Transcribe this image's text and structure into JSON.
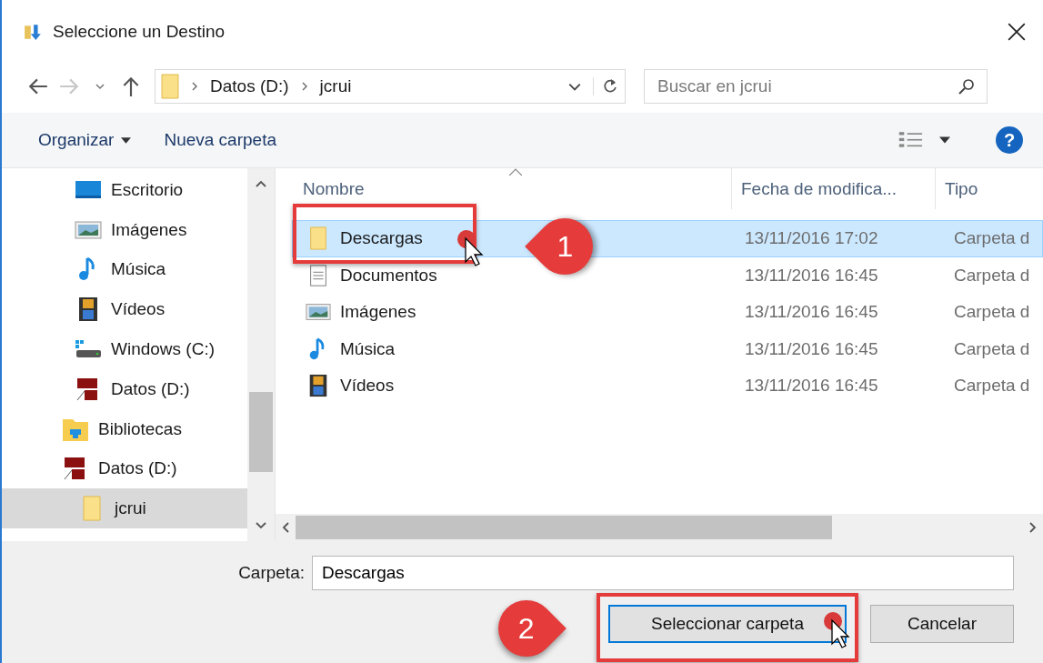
{
  "window": {
    "title": "Seleccione un Destino"
  },
  "address": {
    "crumbs": [
      "Datos (D:)",
      "jcrui"
    ]
  },
  "search": {
    "placeholder": "Buscar en jcrui"
  },
  "toolbar": {
    "organize": "Organizar",
    "new_folder": "Nueva carpeta",
    "help": "?"
  },
  "sidebar": {
    "items": [
      {
        "children": [
          {
            "label": "Escritorio",
            "kind": "desktop",
            "selected": false
          },
          {
            "label": "Imágenes",
            "kind": "pictures",
            "selected": false
          },
          {
            "label": "Música",
            "kind": "music",
            "selected": false
          },
          {
            "label": "Vídeos",
            "kind": "video",
            "selected": false
          },
          {
            "label": "Windows (C:)",
            "kind": "drive",
            "selected": false
          },
          {
            "label": "Datos (D:)",
            "kind": "sd",
            "selected": false
          }
        ]
      },
      {
        "label": "Bibliotecas",
        "kind": "library",
        "selected": false
      },
      {
        "label": "Datos (D:)",
        "kind": "sd",
        "selected": false,
        "children": [
          {
            "label": "jcrui",
            "kind": "folder",
            "selected": true
          }
        ]
      }
    ]
  },
  "table": {
    "columns": [
      "Nombre",
      "Fecha de modifica...",
      "Tipo"
    ],
    "rows": [
      {
        "name": "Descargas",
        "date": "13/11/2016 17:02",
        "type": "Carpeta d",
        "kind": "folder",
        "selected": true
      },
      {
        "name": "Documentos",
        "date": "13/11/2016 16:45",
        "type": "Carpeta d",
        "kind": "documents",
        "selected": false
      },
      {
        "name": "Imágenes",
        "date": "13/11/2016 16:45",
        "type": "Carpeta d",
        "kind": "pictures",
        "selected": false
      },
      {
        "name": "Música",
        "date": "13/11/2016 16:45",
        "type": "Carpeta d",
        "kind": "music",
        "selected": false
      },
      {
        "name": "Vídeos",
        "date": "13/11/2016 16:45",
        "type": "Carpeta d",
        "kind": "video",
        "selected": false
      }
    ]
  },
  "folder_field": {
    "label": "Carpeta:",
    "value": "Descargas"
  },
  "buttons": [
    {
      "label": "Seleccionar carpeta",
      "default": true
    },
    {
      "label": "Cancelar",
      "default": false
    }
  ],
  "annotations": [
    {
      "number": "1"
    },
    {
      "number": "2"
    }
  ]
}
